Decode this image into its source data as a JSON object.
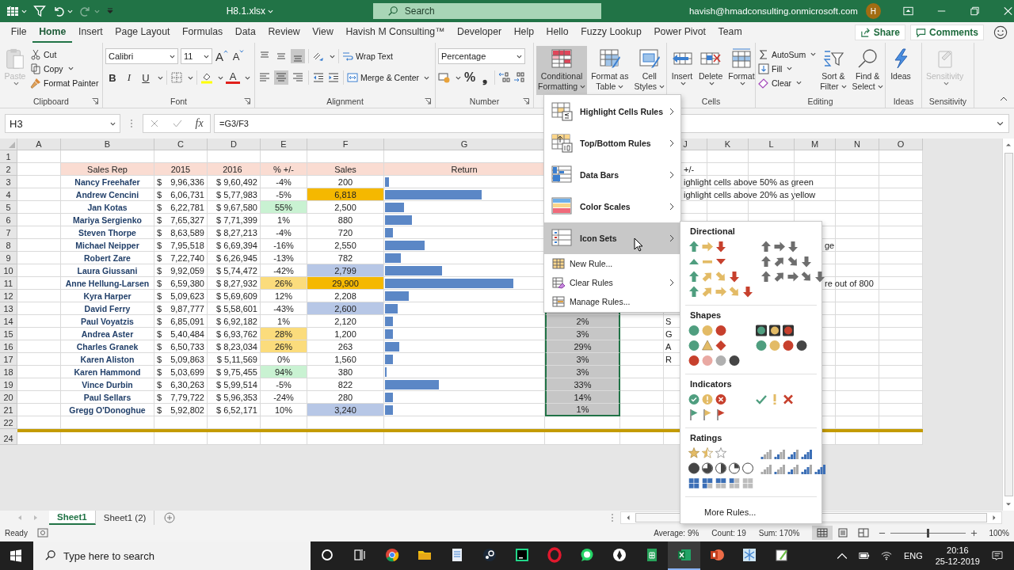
{
  "title_bar": {
    "quick_access": [
      {
        "kind": "grid",
        "disabled": false
      },
      {
        "kind": "filter",
        "disabled": false
      },
      {
        "kind": "undo",
        "disabled": false
      },
      {
        "kind": "redo",
        "disabled": true
      },
      {
        "kind": "customize",
        "disabled": false
      }
    ],
    "file_name": "H8.1.xlsx",
    "search": {
      "placeholder": "Search"
    },
    "account": "havish@hmadconsulting.onmicrosoft.com",
    "avatar": "H"
  },
  "tabs": [
    {
      "label": "File",
      "selected": false
    },
    {
      "label": "Home",
      "selected": true
    },
    {
      "label": "Insert",
      "selected": false
    },
    {
      "label": "Page Layout",
      "selected": false
    },
    {
      "label": "Formulas",
      "selected": false
    },
    {
      "label": "Data",
      "selected": false
    },
    {
      "label": "Review",
      "selected": false
    },
    {
      "label": "View",
      "selected": false
    },
    {
      "label": "Havish M Consulting™",
      "selected": false
    },
    {
      "label": "Developer",
      "selected": false
    },
    {
      "label": "Help",
      "selected": false
    },
    {
      "label": "Hello",
      "selected": false
    },
    {
      "label": "Fuzzy Lookup",
      "selected": false
    },
    {
      "label": "Power Pivot",
      "selected": false
    },
    {
      "label": "Team",
      "selected": false
    }
  ],
  "share": "Share",
  "comments": "Comments",
  "ribbon": {
    "clipboard": {
      "title": "Clipboard",
      "paste": {
        "label": "Paste",
        "disabled": true
      },
      "cut": "Cut",
      "copy": "Copy",
      "format_painter": "Format Painter"
    },
    "font": {
      "title": "Font",
      "family": "Calibri",
      "size": "11",
      "grow": "A",
      "shrink": "A",
      "bold": "B",
      "italic": "I",
      "underline": "U",
      "font_color": "A"
    },
    "alignment": {
      "title": "Alignment",
      "vertical": [
        {
          "kind": "top",
          "selected": false
        },
        {
          "kind": "middle",
          "selected": false
        },
        {
          "kind": "bottom",
          "selected": true
        }
      ],
      "horizontal": [
        {
          "kind": "left",
          "selected": false
        },
        {
          "kind": "center",
          "selected": true
        },
        {
          "kind": "right",
          "selected": false
        }
      ],
      "wrap_text": "Wrap Text",
      "merge": "Merge & Center"
    },
    "number": {
      "title": "Number",
      "format": "Percentage",
      "percent": "%",
      "comma": "❟"
    },
    "styles": {
      "buttons": [
        {
          "kind": "conditional",
          "lines": [
            "Conditional",
            "Formatting"
          ],
          "selected": true
        },
        {
          "kind": "table",
          "lines": [
            "Format as",
            "Table"
          ],
          "selected": false
        },
        {
          "kind": "cellstyles",
          "lines": [
            "Cell",
            "Styles"
          ],
          "selected": false
        }
      ]
    },
    "cells": {
      "title": "Cells",
      "buttons": [
        {
          "kind": "insert",
          "label": "Insert"
        },
        {
          "kind": "delete",
          "label": "Delete"
        },
        {
          "kind": "format",
          "label": "Format"
        }
      ]
    },
    "editing": {
      "title": "Editing",
      "autosum": "AutoSum",
      "fill": "Fill",
      "clear": "Clear",
      "sort": [
        "Sort &",
        "Filter"
      ],
      "find": [
        "Find &",
        "Select"
      ]
    },
    "ideas": {
      "title": "Ideas",
      "label": "Ideas"
    },
    "sensitivity": {
      "title": "Sensitivity",
      "label": "Sensitivity",
      "disabled": true
    }
  },
  "formula_bar": {
    "name_box": "H3",
    "fx": "fx",
    "formula": "=G3/F3"
  },
  "sheet": {
    "column_headers_left": [
      "A",
      "B",
      "C",
      "D",
      "E",
      "F",
      "G"
    ],
    "column_headers_right": [
      "J",
      "K",
      "L",
      "M",
      "N",
      "O"
    ],
    "rows": [
      {
        "number": "1",
        "kind": "blank"
      },
      {
        "number": "2",
        "kind": "header",
        "cells": {
          "name": {
            "text": "Sales Rep",
            "color": "#fadcd2"
          },
          "amount_2015": {
            "text": "2015",
            "color": "#fadcd2"
          },
          "amount_2016": {
            "text": "2016",
            "color": "#fadcd2"
          },
          "change": {
            "text": "% +/-",
            "color": "#fadcd2"
          },
          "sales": {
            "text": "Sales",
            "color": "#fadcd2"
          },
          "return": {
            "text": "Return",
            "color": "#fadcd2"
          },
          "column_j": {
            "text": "+/-"
          }
        }
      },
      {
        "number": "3",
        "kind": "data",
        "cells": {
          "name": {
            "text": "Nancy Freehafer"
          },
          "amount_2015": {
            "symbol": "$",
            "text": "9,96,336"
          },
          "amount_2016": {
            "text": "$ 9,60,492"
          },
          "change": {
            "text": "-4%"
          },
          "sales": {
            "text": "200"
          },
          "return": {
            "level": 0.024
          },
          "column_j": {
            "text": "ighlight cells above 50% as green"
          }
        }
      },
      {
        "number": "4",
        "kind": "data",
        "cells": {
          "name": {
            "text": "Andrew Cencini"
          },
          "amount_2015": {
            "symbol": "$",
            "text": "6,06,731"
          },
          "amount_2016": {
            "text": "$ 5,77,983"
          },
          "change": {
            "text": "-5%"
          },
          "sales": {
            "text": "6,818",
            "color": "#f5b800"
          },
          "return": {
            "level": 0.61
          },
          "column_j": {
            "text": "ighlight cells above 20% as yellow"
          }
        }
      },
      {
        "number": "5",
        "kind": "data",
        "cells": {
          "name": {
            "text": "Jan Kotas"
          },
          "amount_2015": {
            "symbol": "$",
            "text": "6,22,781"
          },
          "amount_2016": {
            "text": "$ 9,67,580"
          },
          "change": {
            "text": "55%",
            "color": "#c9f2d2"
          },
          "sales": {
            "text": "2,500"
          },
          "return": {
            "level": 0.12
          }
        }
      },
      {
        "number": "6",
        "kind": "data",
        "cells": {
          "name": {
            "text": "Mariya Sergienko"
          },
          "amount_2015": {
            "symbol": "$",
            "text": "7,65,327"
          },
          "amount_2016": {
            "text": "$ 7,71,399"
          },
          "change": {
            "text": "1%"
          },
          "sales": {
            "text": "880"
          },
          "return": {
            "level": 0.17
          }
        }
      },
      {
        "number": "7",
        "kind": "data",
        "cells": {
          "name": {
            "text": "Steven Thorpe"
          },
          "amount_2015": {
            "symbol": "$",
            "text": "8,63,589"
          },
          "amount_2016": {
            "text": "$ 8,27,213"
          },
          "change": {
            "text": "-4%"
          },
          "sales": {
            "text": "720"
          },
          "return": {
            "level": 0.05
          }
        }
      },
      {
        "number": "8",
        "kind": "data",
        "cells": {
          "name": {
            "text": "Michael Neipper"
          },
          "amount_2015": {
            "symbol": "$",
            "text": "7,95,518"
          },
          "amount_2016": {
            "text": "$ 6,69,394"
          },
          "change": {
            "text": "-16%"
          },
          "sales": {
            "text": "2,550"
          },
          "return": {
            "level": 0.25
          },
          "column_m": {
            "text": "ge"
          }
        }
      },
      {
        "number": "9",
        "kind": "data",
        "cells": {
          "name": {
            "text": "Robert Zare"
          },
          "amount_2015": {
            "symbol": "$",
            "text": "7,22,740"
          },
          "amount_2016": {
            "text": "$ 6,26,945"
          },
          "change": {
            "text": "-13%"
          },
          "sales": {
            "text": "782"
          },
          "return": {
            "level": 0.1
          }
        }
      },
      {
        "number": "10",
        "kind": "data",
        "cells": {
          "name": {
            "text": "Laura Giussani"
          },
          "amount_2015": {
            "symbol": "$",
            "text": "9,92,059"
          },
          "amount_2016": {
            "text": "$ 5,74,472"
          },
          "change": {
            "text": "-42%"
          },
          "sales": {
            "text": "2,799",
            "color": "#b7c7e6"
          },
          "return": {
            "level": 0.36
          }
        }
      },
      {
        "number": "11",
        "kind": "data",
        "cells": {
          "name": {
            "text": "Anne Hellung-Larsen"
          },
          "amount_2015": {
            "symbol": "$",
            "text": "6,59,380"
          },
          "amount_2016": {
            "text": "$ 8,27,932"
          },
          "change": {
            "text": "26%",
            "color": "#fbdc7c"
          },
          "sales": {
            "text": "29,900",
            "color": "#f5b800"
          },
          "return": {
            "level": 0.81
          },
          "column_m": {
            "text": "re out of 800"
          }
        }
      },
      {
        "number": "12",
        "kind": "data",
        "cells": {
          "name": {
            "text": "Kyra Harper"
          },
          "amount_2015": {
            "symbol": "$",
            "text": "5,09,623"
          },
          "amount_2016": {
            "text": "$ 5,69,609"
          },
          "change": {
            "text": "12%"
          },
          "sales": {
            "text": "2,208"
          },
          "return": {
            "level": 0.15
          }
        }
      },
      {
        "number": "13",
        "kind": "data",
        "cells": {
          "name": {
            "text": "David Ferry"
          },
          "amount_2015": {
            "symbol": "$",
            "text": "9,87,777"
          },
          "amount_2016": {
            "text": "$ 5,58,601"
          },
          "change": {
            "text": "-43%"
          },
          "sales": {
            "text": "2,600",
            "color": "#b7c7e6"
          },
          "return": {
            "level": 0.08
          },
          "column_h": {
            "selected": true
          }
        }
      },
      {
        "number": "14",
        "kind": "data",
        "cells": {
          "name": {
            "text": "Paul Voyatzis"
          },
          "amount_2015": {
            "symbol": "$",
            "text": "6,85,091"
          },
          "amount_2016": {
            "text": "$ 6,92,182"
          },
          "change": {
            "text": "1%"
          },
          "sales": {
            "text": "2,120"
          },
          "return": {
            "level": 0.05
          },
          "column_h": {
            "text": "2%",
            "selected": true
          },
          "column_j": {
            "text": "S"
          }
        }
      },
      {
        "number": "15",
        "kind": "data",
        "cells": {
          "name": {
            "text": "Andrea Aster"
          },
          "amount_2015": {
            "symbol": "$",
            "text": "5,40,484"
          },
          "amount_2016": {
            "text": "$ 6,93,762"
          },
          "change": {
            "text": "28%",
            "color": "#fbdc7c"
          },
          "sales": {
            "text": "1,200"
          },
          "return": {
            "level": 0.05
          },
          "column_h": {
            "text": "3%",
            "selected": true
          },
          "column_j": {
            "text": "G"
          }
        }
      },
      {
        "number": "16",
        "kind": "data",
        "cells": {
          "name": {
            "text": "Charles Granek"
          },
          "amount_2015": {
            "symbol": "$",
            "text": "6,50,733"
          },
          "amount_2016": {
            "text": "$ 8,23,034"
          },
          "change": {
            "text": "26%",
            "color": "#fbdc7c"
          },
          "sales": {
            "text": "263"
          },
          "return": {
            "level": 0.09
          },
          "column_h": {
            "text": "29%",
            "selected": true
          },
          "column_j": {
            "text": "A"
          }
        }
      },
      {
        "number": "17",
        "kind": "data",
        "cells": {
          "name": {
            "text": "Karen Aliston"
          },
          "amount_2015": {
            "symbol": "$",
            "text": "5,09,863"
          },
          "amount_2016": {
            "text": "$ 5,11,569"
          },
          "change": {
            "text": "0%"
          },
          "sales": {
            "text": "1,560"
          },
          "return": {
            "level": 0.05
          },
          "column_h": {
            "text": "3%",
            "selected": true
          },
          "column_j": {
            "text": "R"
          }
        }
      },
      {
        "number": "18",
        "kind": "data",
        "cells": {
          "name": {
            "text": "Karen Hammond"
          },
          "amount_2015": {
            "symbol": "$",
            "text": "5,03,699"
          },
          "amount_2016": {
            "text": "$ 9,75,455"
          },
          "change": {
            "text": "94%",
            "color": "#c9f2d2"
          },
          "sales": {
            "text": "380"
          },
          "return": {
            "level": 0.012
          },
          "column_h": {
            "text": "3%",
            "selected": true
          }
        }
      },
      {
        "number": "19",
        "kind": "data",
        "cells": {
          "name": {
            "text": "Vince Durbin"
          },
          "amount_2015": {
            "symbol": "$",
            "text": "6,30,263"
          },
          "amount_2016": {
            "text": "$ 5,99,514"
          },
          "change": {
            "text": "-5%"
          },
          "sales": {
            "text": "822"
          },
          "return": {
            "level": 0.34
          },
          "column_h": {
            "text": "33%",
            "selected": true
          }
        }
      },
      {
        "number": "20",
        "kind": "data",
        "cells": {
          "name": {
            "text": "Paul Sellars"
          },
          "amount_2015": {
            "symbol": "$",
            "text": "7,79,722"
          },
          "amount_2016": {
            "text": "$ 5,96,353"
          },
          "change": {
            "text": "-24%"
          },
          "sales": {
            "text": "280"
          },
          "return": {
            "level": 0.05
          },
          "column_h": {
            "text": "14%",
            "selected": true
          }
        }
      },
      {
        "number": "21",
        "kind": "data",
        "cells": {
          "name": {
            "text": "Gregg O'Donoghue"
          },
          "amount_2015": {
            "symbol": "$",
            "text": "5,92,802"
          },
          "amount_2016": {
            "text": "$ 6,52,171"
          },
          "change": {
            "text": "10%"
          },
          "sales": {
            "text": "3,240",
            "color": "#b7c7e6"
          },
          "return": {
            "level": 0.05
          },
          "column_h": {
            "text": "1%",
            "selected": true
          }
        }
      },
      {
        "number": "22",
        "kind": "blank"
      },
      {
        "kind": "divider"
      },
      {
        "number": "24",
        "kind": "blank"
      }
    ]
  },
  "sheet_tabs": [
    {
      "label": "Sheet1",
      "selected": true
    },
    {
      "label": "Sheet1 (2)",
      "selected": false
    }
  ],
  "status_bar": {
    "mode": "Ready",
    "average": "Average: 9%",
    "count": "Count: 19",
    "sum": "Sum: 170%",
    "views": [
      {
        "kind": "normal",
        "selected": true
      },
      {
        "kind": "pagelayout",
        "selected": false
      },
      {
        "kind": "pagebreak",
        "selected": false
      }
    ],
    "zoom": {
      "level": 0.5,
      "text": "100%"
    }
  },
  "conditional_menu": {
    "items": [
      {
        "kind": "highlight",
        "label": "Highlight Cells Rules",
        "submenu": true,
        "selected": false
      },
      {
        "kind": "topbottom",
        "label": "Top/Bottom Rules",
        "submenu": true,
        "selected": false
      },
      {
        "kind": "databars",
        "label": "Data Bars",
        "submenu": true,
        "selected": false
      },
      {
        "kind": "colorscales",
        "label": "Color Scales",
        "submenu": true,
        "selected": false
      },
      {
        "kind": "iconsets",
        "label": "Icon Sets",
        "submenu": true,
        "selected": true
      },
      {
        "kind": "newrule",
        "label": "New Rule...",
        "submenu": false,
        "selected": false
      },
      {
        "kind": "clearrules",
        "label": "Clear Rules",
        "submenu": true,
        "selected": false
      },
      {
        "kind": "managerules",
        "label": "Manage Rules...",
        "submenu": false,
        "selected": false
      }
    ]
  },
  "icon_sets_menu": {
    "sections": [
      {
        "title": "Directional",
        "columns": [
          [
            {
              "kind": "arrows3"
            },
            {
              "kind": "triangles3"
            },
            {
              "kind": "arrows4"
            },
            {
              "kind": "arrows5"
            }
          ],
          [
            {
              "kind": "grayarrows3"
            },
            {
              "kind": "grayarrows4"
            },
            {
              "kind": "grayarrows5"
            }
          ]
        ]
      },
      {
        "title": "Shapes",
        "columns": [
          [
            {
              "kind": "lights3"
            },
            {
              "kind": "shapes3"
            },
            {
              "kind": "redtoblack"
            }
          ],
          [
            {
              "kind": "rimmed"
            },
            {
              "kind": "lights4"
            }
          ]
        ]
      },
      {
        "title": "Indicators",
        "columns": [
          [
            {
              "kind": "circledsymbols"
            },
            {
              "kind": "flags"
            }
          ],
          [
            {
              "kind": "symbols"
            }
          ]
        ]
      },
      {
        "title": "Ratings",
        "columns": [
          [
            {
              "kind": "stars"
            },
            {
              "kind": "quarters"
            },
            {
              "kind": "boxes"
            }
          ],
          [
            {
              "kind": "bars4"
            },
            {
              "kind": "bars5"
            }
          ]
        ]
      }
    ],
    "footer": "More Rules..."
  },
  "taskbar": {
    "search_placeholder": "Type here to search",
    "apps": [
      {
        "kind": "cortana",
        "active": false
      },
      {
        "kind": "taskview",
        "active": false
      },
      {
        "kind": "browser",
        "active": false
      },
      {
        "kind": "folder",
        "active": false
      },
      {
        "kind": "document",
        "active": false
      },
      {
        "kind": "disc",
        "active": false
      },
      {
        "kind": "ide",
        "active": false
      },
      {
        "kind": "ring",
        "active": false
      },
      {
        "kind": "chat",
        "active": false
      },
      {
        "kind": "pen",
        "active": false
      },
      {
        "kind": "sheets",
        "active": false
      },
      {
        "kind": "excel",
        "active": true
      },
      {
        "kind": "slides",
        "active": false
      },
      {
        "kind": "snowflake",
        "active": false
      },
      {
        "kind": "paint",
        "active": false
      }
    ],
    "language": "ENG",
    "time": "20:16",
    "date": "25-12-2019"
  }
}
